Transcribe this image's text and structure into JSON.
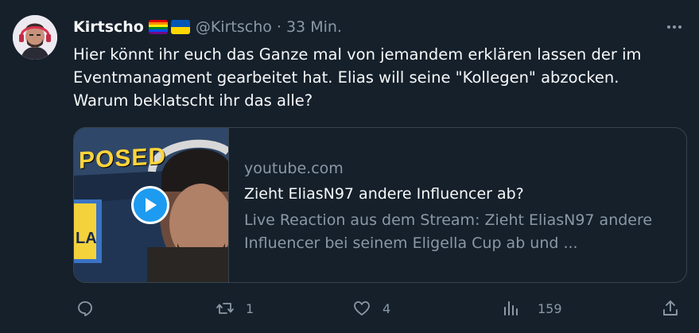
{
  "tweet": {
    "author_name": "Kirtscho",
    "handle_time": "@Kirtscho · 33 Min.",
    "text": "Hier könnt ihr euch das Ganze mal von jemandem erklären lassen der im Eventmanagment gearbeitet hat. Elias will seine \"Kollegen\" abzocken. Warum beklatscht ihr das alle?"
  },
  "card": {
    "domain": "youtube.com",
    "title": "Zieht EliasN97 andere Influencer ab?",
    "description": "Live Reaction aus dem Stream: Zieht EliasN97 andere Influencer bei seinem Eligella Cup ab und ...",
    "thumbnail_overlay_text": "POSED",
    "thumbnail_side_text": "LA"
  },
  "actions": {
    "replies": "",
    "retweets": "1",
    "likes": "4",
    "views": "159"
  },
  "icons": [
    "avatar",
    "rainbow-flag-icon",
    "ukraine-flag-icon",
    "more-icon",
    "play-icon",
    "reply-icon",
    "retweet-icon",
    "like-icon",
    "views-icon",
    "share-icon"
  ],
  "colors": {
    "background": "#15202b",
    "text": "#f7f9f9",
    "muted": "#8b98a5",
    "border": "#38444d",
    "play": "#1d9bf0"
  }
}
